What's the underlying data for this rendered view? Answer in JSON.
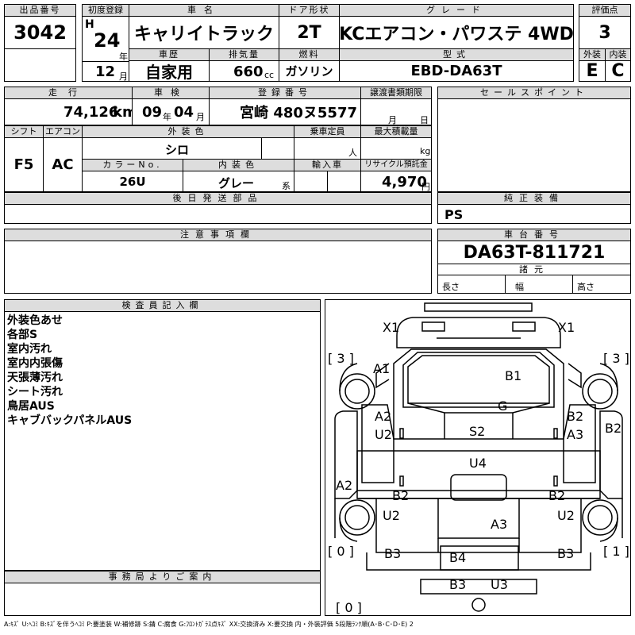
{
  "header": {
    "lot_number_label": "出品番号",
    "lot_number": "3042",
    "first_reg_label": "初度登録",
    "era": "H",
    "year": "24",
    "year_unit": "年",
    "month": "12",
    "month_unit": "月",
    "car_name_label": "車名",
    "car_name": "キャリイトラック",
    "door_label": "ドア形状",
    "door": "2T",
    "grade_label": "グレード",
    "grade": "KCエアコン・パワステ 4WD",
    "score_label": "評価点",
    "score": "3",
    "history_label": "車歴",
    "history": "自家用",
    "displacement_label": "排気量",
    "displacement": "660",
    "displacement_unit": "cc",
    "fuel_label": "燃料",
    "fuel": "ガソリン",
    "model_label": "型式",
    "model": "EBD-DA63T",
    "exterior_label": "外装",
    "exterior": "E",
    "interior_label": "内装",
    "interior": "C"
  },
  "row2": {
    "mileage_label": "走行",
    "mileage": "74,126",
    "mileage_unit": "km",
    "inspection_label": "車検",
    "inspection_year": "09",
    "inspection_year_unit": "年",
    "inspection_month": "04",
    "inspection_month_unit": "月",
    "plate_label": "登録番号",
    "plate": "宮崎 480ヌ5577",
    "transfer_label": "譲渡書類期限",
    "transfer_month_unit": "月",
    "transfer_day_unit": "日",
    "sales_point_label": "セールスポイント"
  },
  "row3": {
    "shift_label": "シフト",
    "shift": "F5",
    "ac_label": "エアコン",
    "ac": "AC",
    "ext_color_label": "外装色",
    "ext_color": "シロ",
    "capacity_label": "乗車定員",
    "capacity_unit": "人",
    "max_load_label": "最大積載量",
    "max_load_unit": "kg",
    "color_no_label": "カラーNo.",
    "color_no": "26U",
    "int_color_label": "内装色",
    "int_color": "グレー",
    "int_color_unit": "系",
    "import_label": "輸入車",
    "recycle_label": "リサイクル預託金",
    "recycle": "4,970",
    "recycle_unit": "円"
  },
  "later_parts_label": "後日発送部品",
  "genuine_label": "純正装備",
  "genuine": "PS",
  "caution_label": "注意事項欄",
  "chassis_label": "車台番号",
  "chassis": "DA63T-811721",
  "specs_label": "諸元",
  "length_label": "長さ",
  "width_label": "幅",
  "height_label": "高さ",
  "inspector_label": "検査員記入欄",
  "inspector_notes": [
    "外装色あせ",
    "各部S",
    "室内汚れ",
    "室内内張傷",
    "天張薄汚れ",
    "シート汚れ",
    "鳥居AUS",
    "キャブバックパネルAUS"
  ],
  "office_label": "事務局よりご案内",
  "diagram": {
    "marks": {
      "x1_left": "X1",
      "x1_right": "X1",
      "tire_fl": "[ 3 ]",
      "tire_fr": "[ 3 ]",
      "a1": "A1",
      "b1": "B1",
      "g": "G",
      "a2_left": "A2",
      "u2_left": "U2",
      "s2": "S2",
      "b2_right": "B2",
      "a3_right": "A3",
      "b2_far_right": "B2",
      "u4": "U4",
      "a2_side": "A2",
      "b2_mid_left": "B2",
      "b2_mid_right": "B2",
      "u2_rear_left": "U2",
      "u2_rear_right": "U2",
      "a3_bed": "A3",
      "tire_rl": "[ 0 ]",
      "tire_rr": "[ 1 ]",
      "b3_left": "B3",
      "b4": "B4",
      "b3_right": "B3",
      "b3_bottom": "B3",
      "u3_bottom": "U3",
      "spare": "[ 0 ]"
    }
  },
  "legend": "A:ｷｽﾞ U:ﾍｺﾐ B:ｷｽﾞを伴うﾍｺﾐ P:要塗装 W:補修跡 S:錆 C:腐食 G:ﾌﾛﾝﾄｶﾞﾗｽ点ｷｽﾞ XX:交換済み X:要交換 内・外装評価 5段階ﾗﾝｸ順(A･B･C･D･E) 2"
}
